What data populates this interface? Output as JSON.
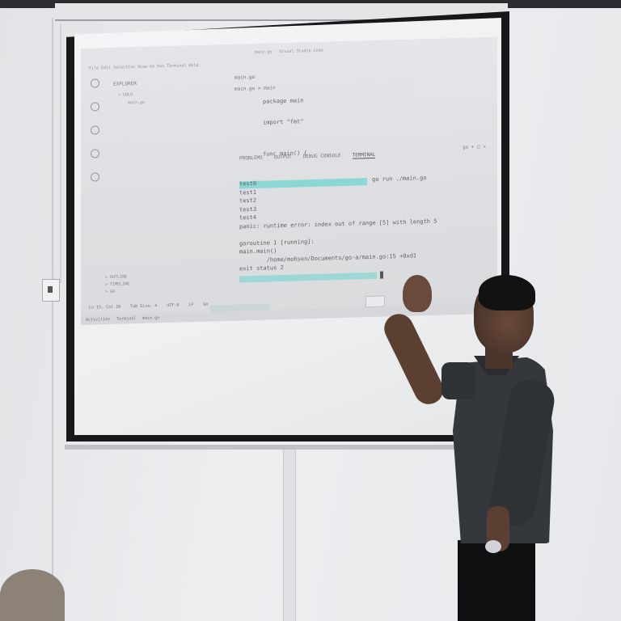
{
  "window": {
    "title": "main.go - Visual Studio Code"
  },
  "menubar": {
    "text": "File Edit Selection View Go Run Terminal Help"
  },
  "sidebar": {
    "title": "EXPLORER",
    "folder": "> GOLO",
    "file": "main.go",
    "outline": [
      "> OUTLINE",
      "> TIMELINE",
      "> GO"
    ]
  },
  "editor": {
    "tab": "main.go",
    "breadcrumb": "main.go > main",
    "code": "package main\n\nimport \"fmt\"\n\n\nfunc main() {"
  },
  "panel": {
    "tabs": [
      "PROBLEMS",
      "OUTPUT",
      "DEBUG CONSOLE",
      "TERMINAL"
    ],
    "active_tab": "TERMINAL",
    "controls": "go  +  □  ✕"
  },
  "terminal": {
    "command": "go run ./main.go",
    "output": "test0\ntest1\ntest2\ntest3\ntest4\npanic: runtime error: index out of range [5] with length 5\n\ngoroutine 1 [running]:\nmain.main()\n        /home/mohsen/Documents/go-a/main.go:15 +0xd1\nexit status 2"
  },
  "statusbar": {
    "items": [
      "Ln 15, Col 28",
      "Tab Size: 4",
      "UTF-8",
      "LF",
      "Go"
    ]
  },
  "taskbar": {
    "items": [
      "Activities",
      "Terminal",
      "main.go"
    ]
  }
}
